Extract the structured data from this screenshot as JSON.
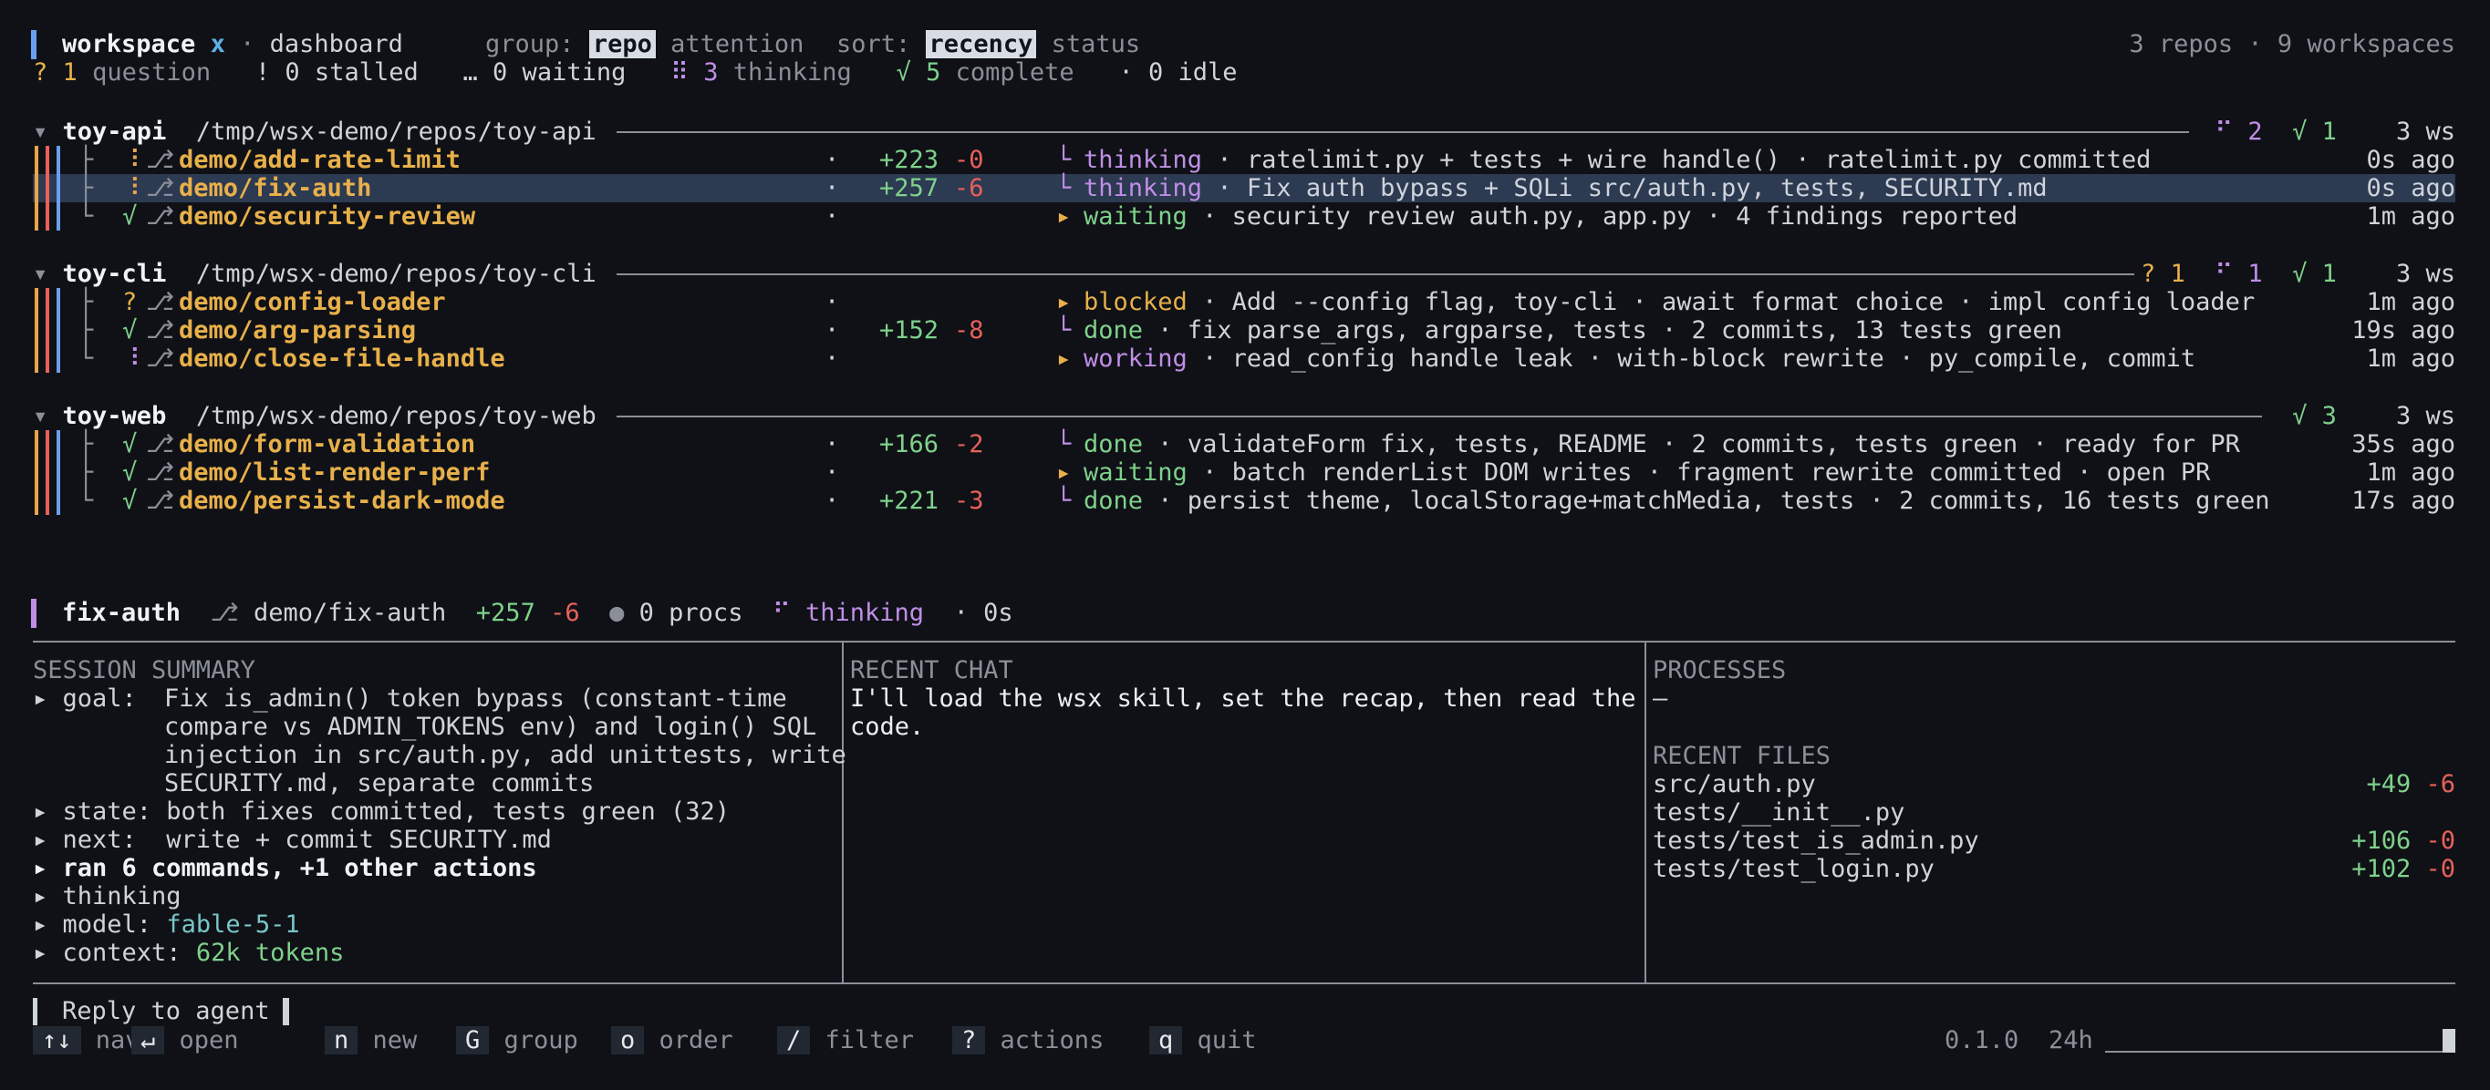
{
  "header": {
    "title": "workspace",
    "close": "x",
    "sep": "·",
    "view": "dashboard",
    "group_label": "group:",
    "group_active": "repo",
    "group_alt": "attention",
    "sort_label": "sort:",
    "sort_active": "recency",
    "sort_alt": "status",
    "summary": "3 repos · 9 workspaces"
  },
  "status_counts": {
    "question_icon": "?",
    "question_count": "1",
    "question_label": "question",
    "stalled_icon": "!",
    "stalled_text": "0 stalled",
    "waiting_icon": "…",
    "waiting_text": "0 waiting",
    "thinking_icon": "⠿",
    "thinking_count": "3",
    "thinking_label": "thinking",
    "complete_icon": "√",
    "complete_count": "5",
    "complete_label": "complete",
    "idle_icon": "·",
    "idle_text": "0 idle"
  },
  "repos": [
    {
      "name": "toy-api",
      "path": "/tmp/wsx-demo/repos/toy-api",
      "badges": [
        {
          "text": "⠋ 2",
          "color": "purple"
        },
        {
          "text": "√ 1",
          "color": "green"
        }
      ],
      "ws": "3 ws",
      "rows": [
        {
          "tree": "├",
          "status": "⠸",
          "status_color": "orange",
          "branch": "demo/add-rate-limit",
          "dot": "·",
          "add": "+223",
          "del": "-0",
          "arrow": "└",
          "state": "thinking",
          "state_color": "purple",
          "desc": "· ratelimit.py + tests + wire handle() · ratelimit.py committed",
          "time": "0s ago"
        },
        {
          "tree": "├",
          "status": "⠸",
          "status_color": "orange",
          "branch": "demo/fix-auth",
          "dot": "·",
          "add": "+257",
          "del": "-6",
          "arrow": "└",
          "state": "thinking",
          "state_color": "purple",
          "desc": "· Fix auth bypass + SQLi src/auth.py, tests, SECURITY.md",
          "time": "0s ago"
        },
        {
          "tree": "└",
          "status": "√",
          "status_color": "green",
          "branch": "demo/security-review",
          "dot": "·",
          "add": "",
          "del": "",
          "arrow": "▸",
          "state": "waiting",
          "state_color": "green",
          "desc": "· security review auth.py, app.py · 4 findings reported",
          "time": "1m ago"
        }
      ]
    },
    {
      "name": "toy-cli",
      "path": "/tmp/wsx-demo/repos/toy-cli",
      "badges": [
        {
          "text": "? 1",
          "color": "yellow"
        },
        {
          "text": "⠋ 1",
          "color": "purple"
        },
        {
          "text": "√ 1",
          "color": "green"
        }
      ],
      "ws": "3 ws",
      "rows": [
        {
          "tree": "├",
          "status": "?",
          "status_color": "yellow",
          "branch": "demo/config-loader",
          "dot": "·",
          "add": "",
          "del": "",
          "arrow": "▸",
          "state": "blocked",
          "state_color": "yellow",
          "desc": "· Add --config flag, toy-cli · await format choice · impl config loader",
          "time": "1m ago"
        },
        {
          "tree": "├",
          "status": "√",
          "status_color": "green",
          "branch": "demo/arg-parsing",
          "dot": "·",
          "add": "+152",
          "del": "-8",
          "arrow": "└",
          "state": "done",
          "state_color": "green",
          "desc": "· fix parse_args, argparse, tests · 2 commits, 13 tests green",
          "time": "19s ago"
        },
        {
          "tree": "└",
          "status": "⠸",
          "status_color": "purple",
          "branch": "demo/close-file-handle",
          "dot": "·",
          "add": "",
          "del": "",
          "arrow": "▸",
          "state": "working",
          "state_color": "purple",
          "desc": "· read_config handle leak · with-block rewrite · py_compile, commit",
          "time": "1m ago"
        }
      ]
    },
    {
      "name": "toy-web",
      "path": "/tmp/wsx-demo/repos/toy-web",
      "badges": [
        {
          "text": "√ 3",
          "color": "green"
        }
      ],
      "ws": "3 ws",
      "rows": [
        {
          "tree": "├",
          "status": "√",
          "status_color": "green",
          "branch": "demo/form-validation",
          "dot": "·",
          "add": "+166",
          "del": "-2",
          "arrow": "└",
          "state": "done",
          "state_color": "green",
          "desc": "· validateForm fix, tests, README · 2 commits, tests green · ready for PR",
          "time": "35s ago"
        },
        {
          "tree": "├",
          "status": "√",
          "status_color": "green",
          "branch": "demo/list-render-perf",
          "dot": "·",
          "add": "",
          "del": "",
          "arrow": "▸",
          "state": "waiting",
          "state_color": "green",
          "desc": "· batch renderList DOM writes · fragment rewrite committed · open PR",
          "time": "1m ago"
        },
        {
          "tree": "└",
          "status": "√",
          "status_color": "green",
          "branch": "demo/persist-dark-mode",
          "dot": "·",
          "add": "+221",
          "del": "-3",
          "arrow": "└",
          "state": "done",
          "state_color": "green",
          "desc": "· persist theme, localStorage+matchMedia, tests · 2 commits, 16 tests green",
          "time": "17s ago"
        }
      ]
    }
  ],
  "detail": {
    "name": "fix-auth",
    "branch_icon": "⎇",
    "branch": "demo/fix-auth",
    "add": "+257",
    "del": "-6",
    "procs_icon": "●",
    "procs": "0 procs",
    "state_icon": "⠋",
    "state": "thinking",
    "age": "· 0s"
  },
  "session": {
    "title": "SESSION SUMMARY",
    "goal_label": "▸ goal:",
    "goal_lines": [
      "Fix is_admin() token bypass (constant-time",
      "compare vs ADMIN_TOKENS env) and login() SQL",
      "injection in src/auth.py, add unittests, write",
      "SECURITY.md, separate commits"
    ],
    "state": "▸ state: both fixes committed, tests green (32)",
    "next": "▸ next:  write + commit SECURITY.md",
    "ran": "▸ ran 6 commands, +1 other actions",
    "thinking": "▸ thinking",
    "model_label": "▸ model: ",
    "model": "fable-5-1",
    "context_label": "▸ context: ",
    "context": "62k tokens"
  },
  "chat": {
    "title": "RECENT CHAT",
    "lines": [
      "I'll load the wsx skill, set the recap, then read the",
      "code."
    ]
  },
  "processes": {
    "title": "PROCESSES",
    "empty": "—",
    "files_title": "RECENT FILES",
    "files": [
      {
        "name": "src/auth.py",
        "add": "+49",
        "del": "-6"
      },
      {
        "name": "tests/__init__.py",
        "add": "",
        "del": ""
      },
      {
        "name": "tests/test_is_admin.py",
        "add": "+106",
        "del": "-0"
      },
      {
        "name": "tests/test_login.py",
        "add": "+102",
        "del": "-0"
      }
    ]
  },
  "reply": {
    "placeholder": "Reply to agent"
  },
  "keys": [
    {
      "key": "↑↓",
      "label": "nav"
    },
    {
      "key": "↵",
      "label": "open"
    },
    {
      "key": "n",
      "label": "new"
    },
    {
      "key": "G",
      "label": "group"
    },
    {
      "key": "o",
      "label": "order"
    },
    {
      "key": "/",
      "label": "filter"
    },
    {
      "key": "?",
      "label": "actions"
    },
    {
      "key": "q",
      "label": "quit"
    }
  ],
  "footer": {
    "version": "0.1.0",
    "window": "24h"
  },
  "colors": {
    "background": "#0f1116",
    "selection": "#2c3a52",
    "accent_blue": "#6a9ff0",
    "accent_purple": "#c08ee6",
    "accent_orange": "#e8a54b",
    "green": "#7fd18b",
    "red": "#e8615a"
  }
}
